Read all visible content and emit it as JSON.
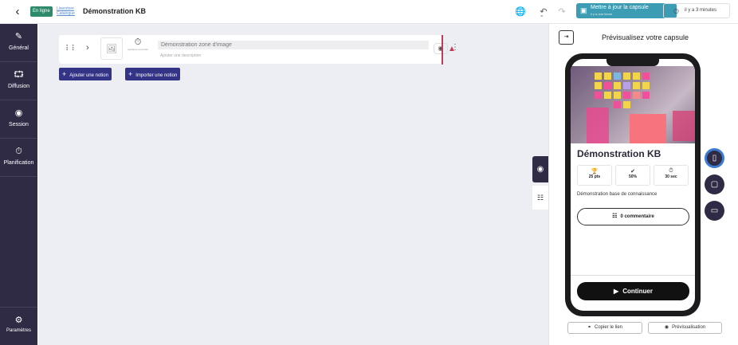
{
  "header": {
    "status": "En ligne",
    "links": [
      "Liserstore",
      "Catalogue"
    ],
    "title": "Démonstration KB",
    "undo_label": "40",
    "update_button": {
      "label": "Mettre à jour la capsule",
      "sublabel": "il y a une heure"
    },
    "last_saved": "il y a 3 minutes"
  },
  "sidebar": {
    "items": [
      {
        "label": "Général",
        "icon": "pencil-icon"
      },
      {
        "label": "Diffusion",
        "icon": "share-icon"
      },
      {
        "label": "Session",
        "icon": "target-icon"
      },
      {
        "label": "Planification",
        "icon": "stopwatch-icon"
      }
    ],
    "settings_label": "Paramètres"
  },
  "editor": {
    "notion": {
      "timer_label": "quelques secondes",
      "zone_placeholder": "Démonstration zone d'image",
      "description_placeholder": "Ajouter une description"
    },
    "add_notion_label": "Ajouter une notion",
    "import_notion_label": "Importer une notion"
  },
  "preview": {
    "title": "Prévisualisez votre capsule",
    "card_title": "Démonstration KB",
    "stats": [
      {
        "icon": "trophy-icon",
        "value": "25 pts"
      },
      {
        "icon": "check-circle-icon",
        "value": "50%"
      },
      {
        "icon": "timer-icon",
        "value": "30 sec"
      }
    ],
    "description": "Démonstration base de connaissance",
    "comments_label": "0 commentaire",
    "continue_label": "Continuer",
    "copy_link_label": "Copier le lien",
    "preview_label": "Prévisualisation"
  },
  "colors": {
    "sidebar": "#2f2b44",
    "accent_button": "#333486",
    "update_button": "#3c9cb3",
    "status_pill": "#2f8a6b",
    "warning": "#c23a55",
    "active_device": "#3d7bd3"
  }
}
